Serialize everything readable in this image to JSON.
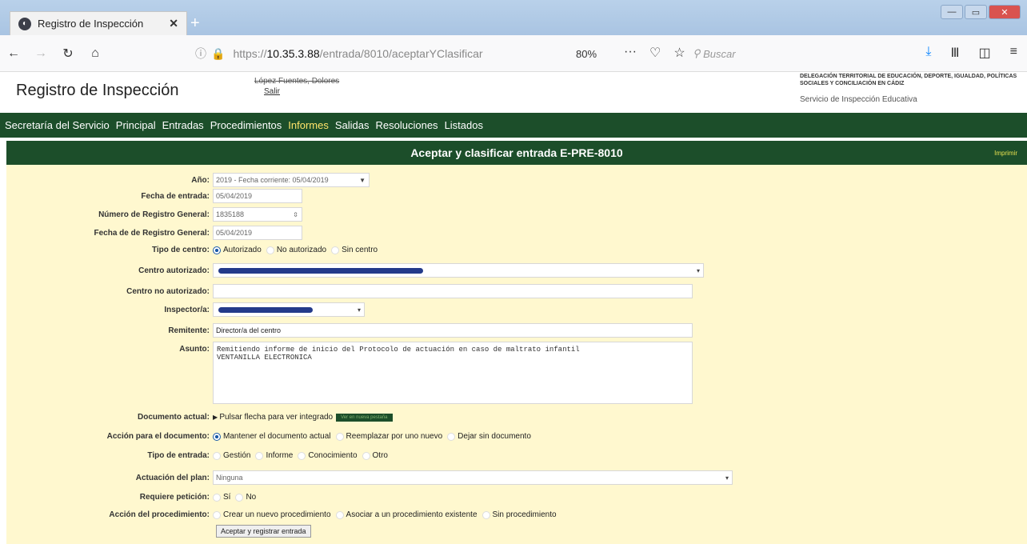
{
  "browser": {
    "tab_title": "Registro de Inspección",
    "url_prefix": "https://",
    "url_host": "10.35.3.88",
    "url_path": "/entrada/8010/aceptarYClasificar",
    "zoom": "80%",
    "search_placeholder": "Buscar"
  },
  "header": {
    "site_title": "Registro de Inspección",
    "user_name": "López Fuentes, Dolores",
    "logout_label": "Salir",
    "delegation": "Delegación Territorial de Educación, Deporte, Igualdad, Políticas Sociales y Conciliación en Cádiz",
    "service": "Servicio de Inspección Educativa"
  },
  "menu": [
    "Secretaría del Servicio",
    "Principal",
    "Entradas",
    "Procedimientos",
    "Informes",
    "Salidas",
    "Resoluciones",
    "Listados"
  ],
  "page": {
    "title": "Aceptar y clasificar entrada E-PRE-8010",
    "print_label": "Imprimir"
  },
  "form": {
    "year_label": "Año:",
    "year_value": "2019 - Fecha corriente: 05/04/2019",
    "entry_date_label": "Fecha de entrada:",
    "entry_date_value": "05/04/2019",
    "reg_number_label": "Número de Registro General:",
    "reg_number_value": "1835188",
    "reg_date_label": "Fecha de de Registro General:",
    "reg_date_value": "05/04/2019",
    "center_type_label": "Tipo de centro:",
    "center_type_options": [
      "Autorizado",
      "No autorizado",
      "Sin centro"
    ],
    "authorized_center_label": "Centro autorizado:",
    "unauthorized_center_label": "Centro no autorizado:",
    "inspector_label": "Inspector/a:",
    "sender_label": "Remitente:",
    "sender_value": "Director/a del centro",
    "subject_label": "Asunto:",
    "subject_value": "Remitiendo informe de inicio del Protocolo de actuación en caso de maltrato infantil\nVENTANILLA ELECTRONICA",
    "document_label": "Documento actual:",
    "document_hint": "Pulsar flecha para ver integrado",
    "document_newtab": "Ver en nueva pestaña",
    "doc_action_label": "Acción para el documento:",
    "doc_action_options": [
      "Mantener el documento actual",
      "Reemplazar por uno nuevo",
      "Dejar sin documento"
    ],
    "entry_type_label": "Tipo de entrada:",
    "entry_type_options": [
      "Gestión",
      "Informe",
      "Conocimiento",
      "Otro"
    ],
    "plan_label": "Actuación del plan:",
    "plan_value": "Ninguna",
    "petition_label": "Requiere petición:",
    "petition_options": [
      "Sí",
      "No"
    ],
    "procedure_label": "Acción del procedimiento:",
    "procedure_options": [
      "Crear un nuevo procedimiento",
      "Asociar a un procedimiento existente",
      "Sin procedimiento"
    ],
    "submit_label": "Aceptar y registrar entrada"
  }
}
